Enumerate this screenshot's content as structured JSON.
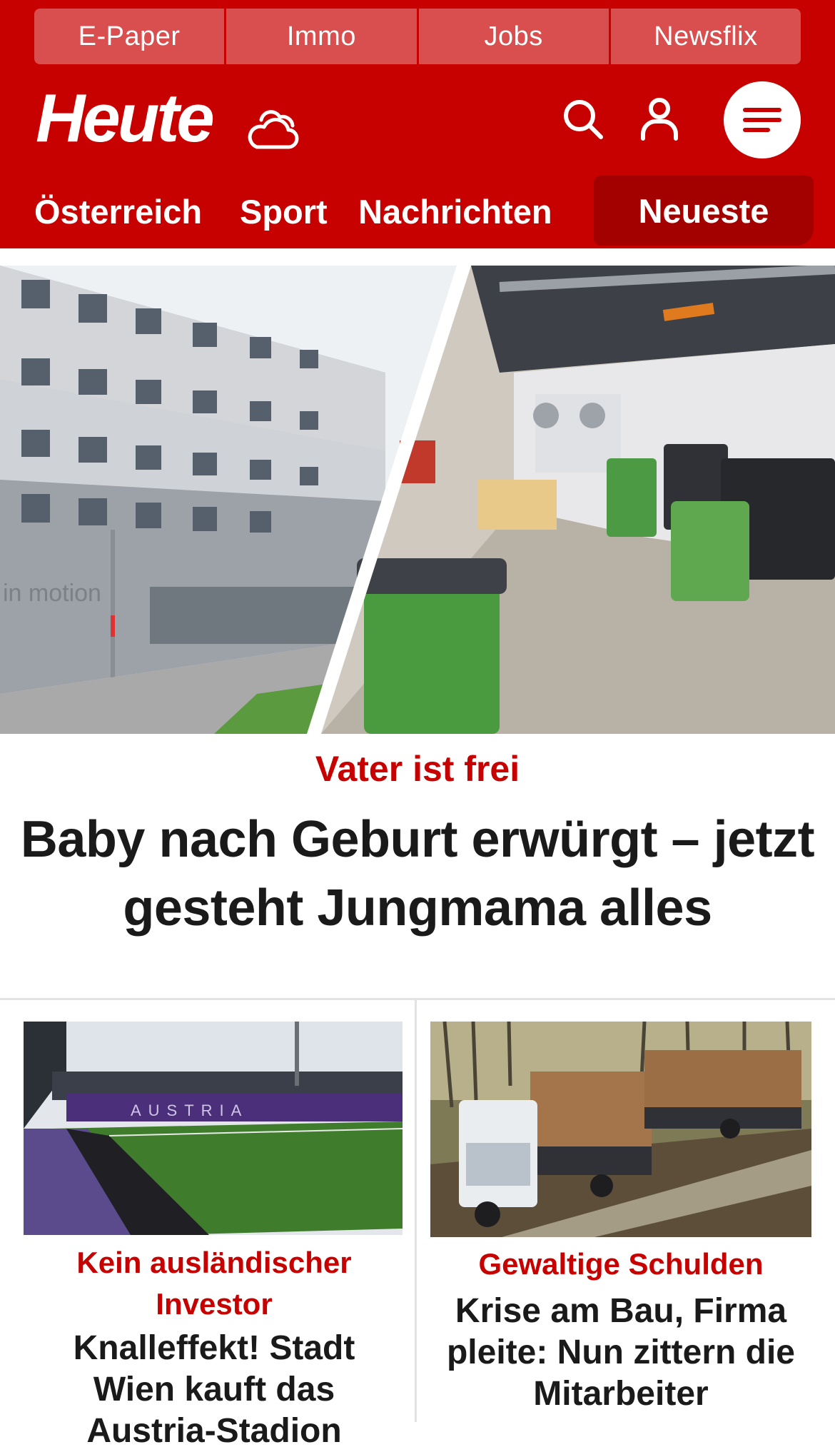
{
  "header": {
    "service_links": [
      "E-Paper",
      "Immo",
      "Jobs",
      "Newsflix"
    ],
    "logo_text": "Heute",
    "icons": {
      "weather": "cloud-weather-icon",
      "search": "search-icon",
      "account": "user-icon",
      "menu": "hamburger-menu-icon"
    },
    "sections": [
      "Österreich",
      "Sport",
      "Nachrichten",
      "Neueste"
    ],
    "active_section": "Neueste",
    "brand_color": "#c70000"
  },
  "hero": {
    "image": "split photo: office building and garbage room with bins",
    "kicker": "Vater ist frei",
    "title": "Baby nach Geburt erwürgt – jetzt gesteht Jungmama alles"
  },
  "cards": [
    {
      "image": "football stadium with purple seats",
      "kicker": "Kein ausländischer Investor",
      "title": "Knalleffekt! Stadt Wien kauft das Austria-Stadion"
    },
    {
      "image": "timber truck in forest",
      "kicker": "Gewaltige Schulden",
      "title": "Krise am Bau, Firma pleite: Nun zittern die Mitarbeiter"
    }
  ]
}
